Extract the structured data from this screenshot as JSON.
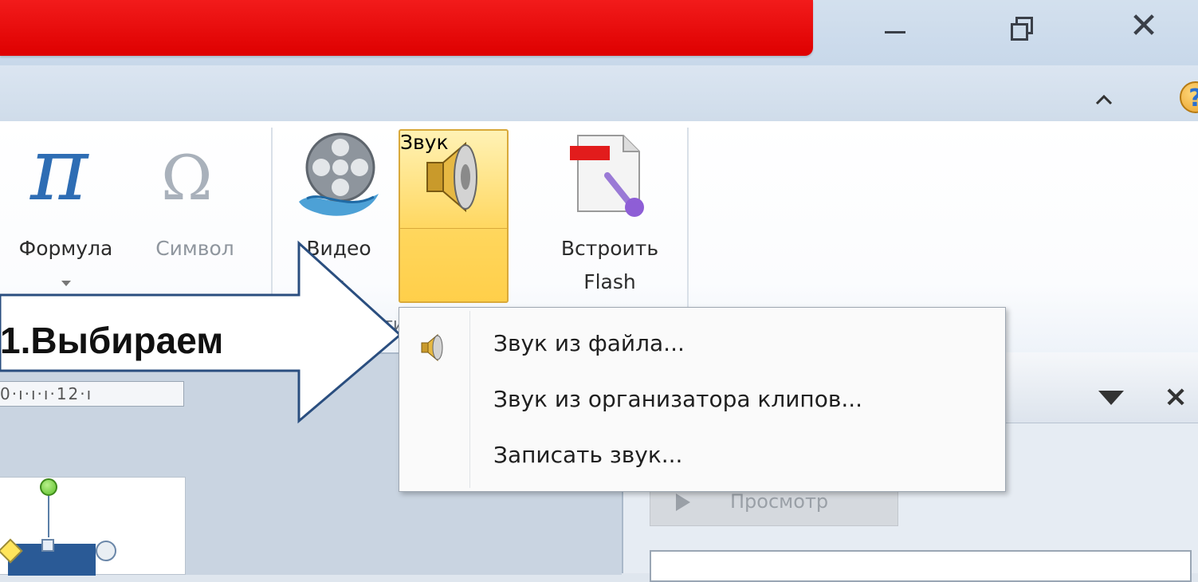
{
  "window": {
    "accent_color": "#e60000",
    "controls": {
      "minimize": "minimize-icon",
      "restore": "restore-icon",
      "close": "✕"
    }
  },
  "tabstrip": {
    "collapse_icon": "ᨈ",
    "help": "?"
  },
  "ribbon": {
    "buttons": [
      {
        "id": "formula",
        "label": "Формула",
        "icon": "pi-icon",
        "has_dropdown": true,
        "enabled": true
      },
      {
        "id": "symbol",
        "label": "Символ",
        "icon": "omega-icon",
        "has_dropdown": false,
        "enabled": false
      },
      {
        "id": "video",
        "label": "Видео",
        "icon": "film-reel-icon",
        "has_dropdown": true,
        "enabled": true
      },
      {
        "id": "sound",
        "label": "Звук",
        "icon": "speaker-icon",
        "has_dropdown": true,
        "enabled": true,
        "active": true
      },
      {
        "id": "embed_flash",
        "label_line1": "Встроить",
        "label_line2": "Flash",
        "icon": "flash-document-icon",
        "has_dropdown": false,
        "enabled": true
      }
    ],
    "pi_glyph": "π",
    "omega_glyph": "Ω",
    "group_label_fragment": "ти"
  },
  "sound_menu": {
    "items": [
      {
        "label": "Звук из файла...",
        "icon": "speaker-icon"
      },
      {
        "label": "Звук из организатора клипов..."
      },
      {
        "label": "Записать звук..."
      }
    ]
  },
  "ruler": {
    "text": "0·ı·ı·ı·12·ı"
  },
  "taskpane": {
    "preview_label": "Просмотр"
  },
  "callout": {
    "text": "1.Выбираем"
  }
}
